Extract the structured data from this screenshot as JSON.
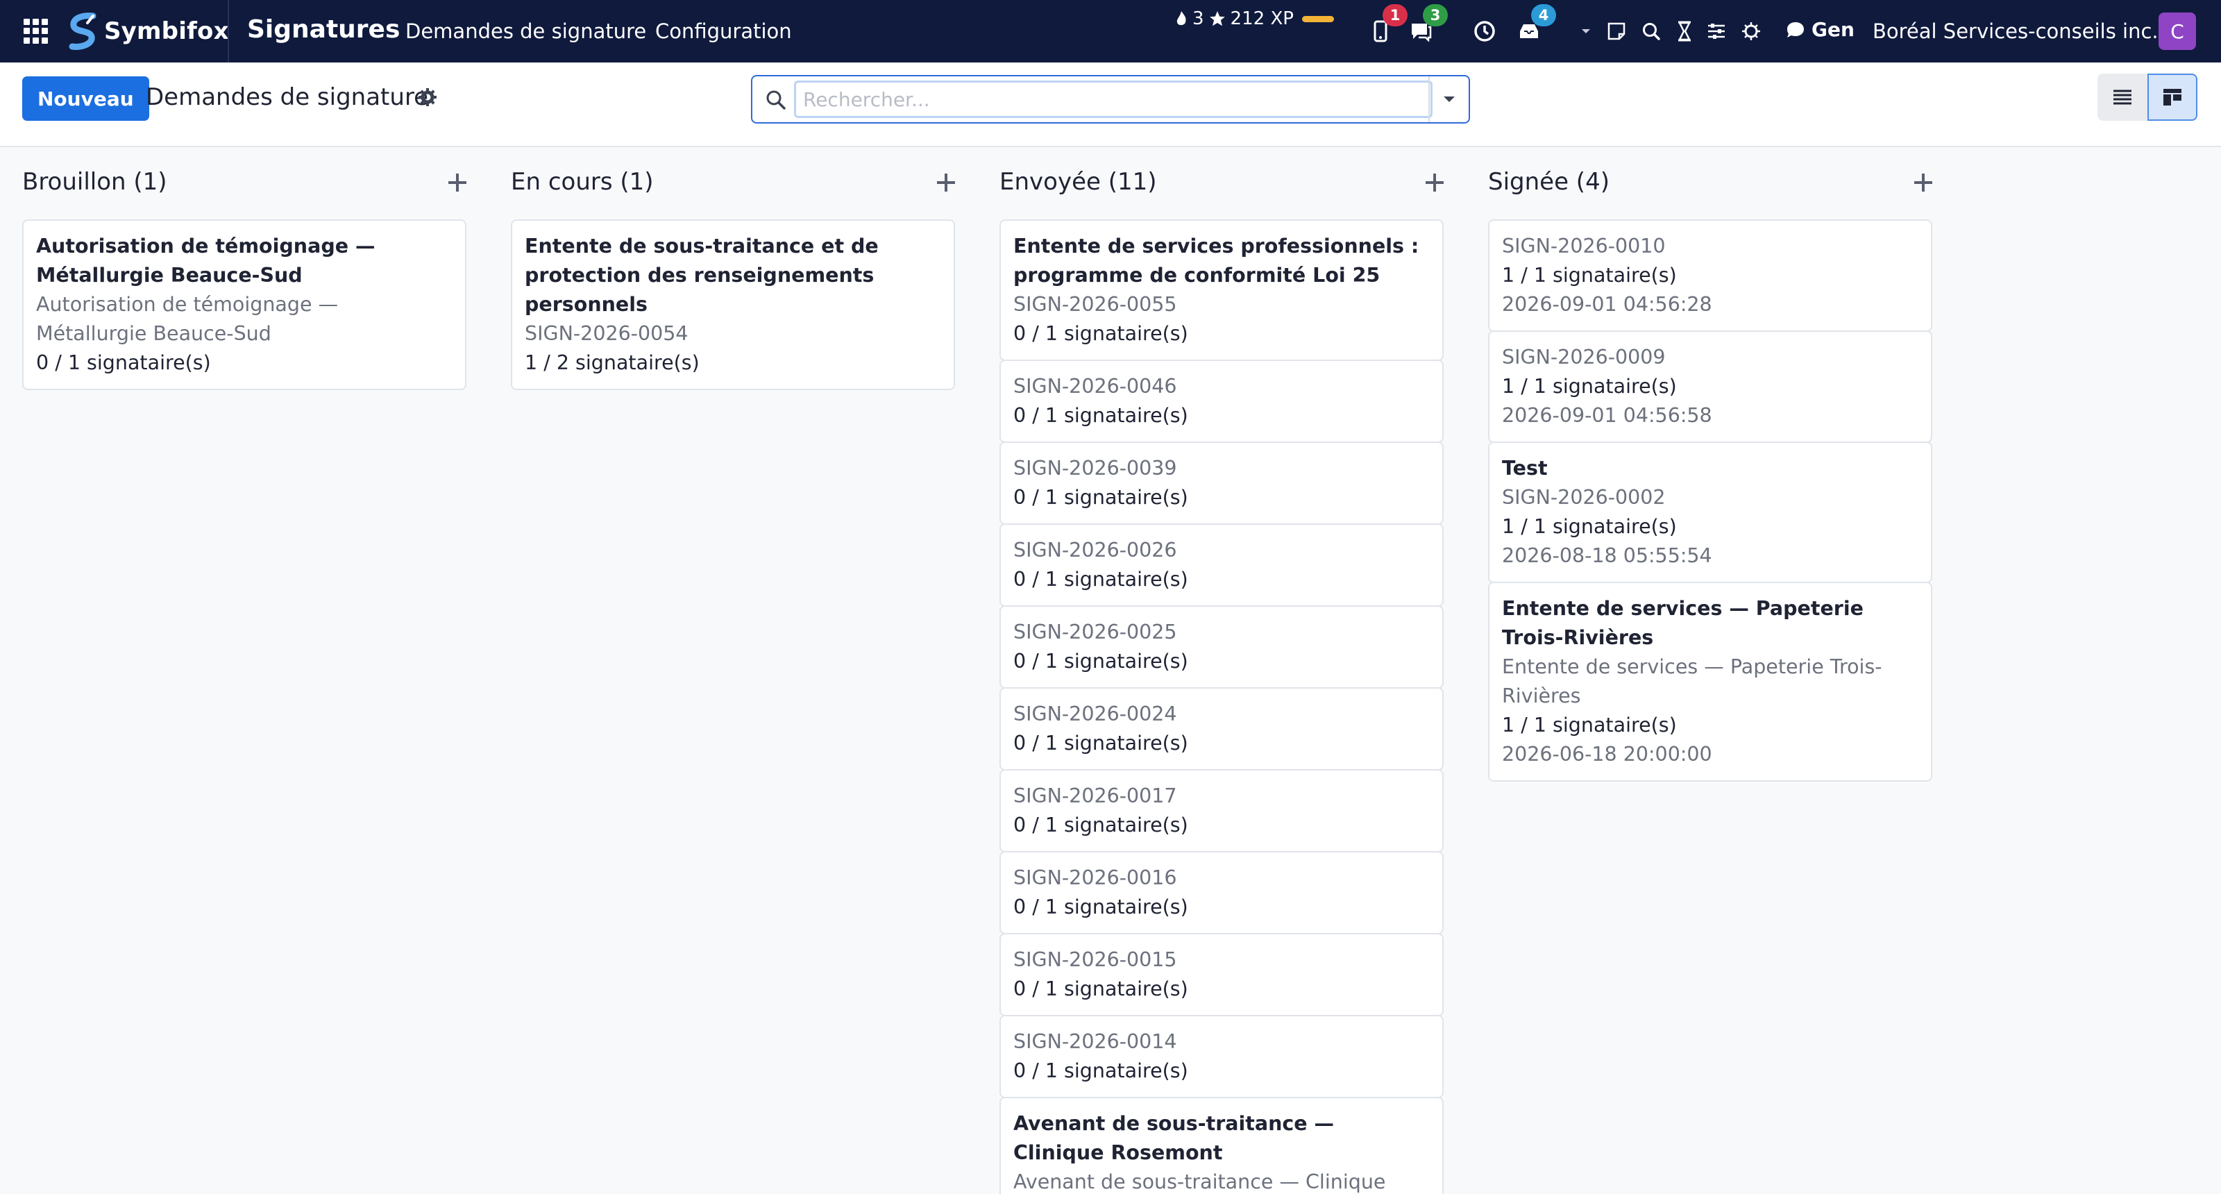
{
  "navbar": {
    "brand": "Symbifox",
    "app_title": "Signatures",
    "menu": [
      "Demandes de signature",
      "Configuration"
    ],
    "xp": {
      "level": "3",
      "points": "212 XP"
    },
    "badges": {
      "mobile": "1",
      "chat": "3",
      "activity": "4"
    },
    "gen_label": "Gen",
    "company": "Boréal Services-conseils inc.",
    "avatar_letter": "C"
  },
  "control": {
    "new_label": "Nouveau",
    "page_title": "Demandes de signature",
    "search_placeholder": "Rechercher..."
  },
  "columns": [
    {
      "title": "Brouillon (1)",
      "cards": [
        {
          "title": "Autorisation de témoignage — Métallurgie Beauce-Sud",
          "subtitle": "Autorisation de témoignage — Métallurgie Beauce-Sud",
          "signers": "0 / 1 signataire(s)"
        }
      ]
    },
    {
      "title": "En cours (1)",
      "cards": [
        {
          "title": "Entente de sous-traitance et de protection des renseignements personnels",
          "subtitle": "SIGN-2026-0054",
          "signers": "1 / 2 signataire(s)"
        }
      ]
    },
    {
      "title": "Envoyée (11)",
      "cards": [
        {
          "title": "Entente de services professionnels : programme de conformité Loi 25",
          "subtitle": "SIGN-2026-0055",
          "signers": "0 / 1 signataire(s)"
        },
        {
          "subtitle": "SIGN-2026-0046",
          "signers": "0 / 1 signataire(s)"
        },
        {
          "subtitle": "SIGN-2026-0039",
          "signers": "0 / 1 signataire(s)"
        },
        {
          "subtitle": "SIGN-2026-0026",
          "signers": "0 / 1 signataire(s)"
        },
        {
          "subtitle": "SIGN-2026-0025",
          "signers": "0 / 1 signataire(s)"
        },
        {
          "subtitle": "SIGN-2026-0024",
          "signers": "0 / 1 signataire(s)"
        },
        {
          "subtitle": "SIGN-2026-0017",
          "signers": "0 / 1 signataire(s)"
        },
        {
          "subtitle": "SIGN-2026-0016",
          "signers": "0 / 1 signataire(s)"
        },
        {
          "subtitle": "SIGN-2026-0015",
          "signers": "0 / 1 signataire(s)"
        },
        {
          "subtitle": "SIGN-2026-0014",
          "signers": "0 / 1 signataire(s)"
        },
        {
          "title": "Avenant de sous-traitance — Clinique Rosemont",
          "subtitle": "Avenant de sous-traitance — Clinique"
        }
      ]
    },
    {
      "title": "Signée (4)",
      "cards": [
        {
          "subtitle": "SIGN-2026-0010",
          "signers": "1 / 1 signataire(s)",
          "date": "2026-09-01 04:56:28"
        },
        {
          "subtitle": "SIGN-2026-0009",
          "signers": "1 / 1 signataire(s)",
          "date": "2026-09-01 04:56:58"
        },
        {
          "title": "Test",
          "subtitle": "SIGN-2026-0002",
          "signers": "1 / 1 signataire(s)",
          "date": "2026-08-18 05:55:54"
        },
        {
          "title": "Entente de services — Papeterie Trois-Rivières",
          "subtitle": "Entente de services — Papeterie Trois-Rivières",
          "signers": "1 / 1 signataire(s)",
          "date": "2026-06-18 20:00:00"
        }
      ]
    }
  ]
}
